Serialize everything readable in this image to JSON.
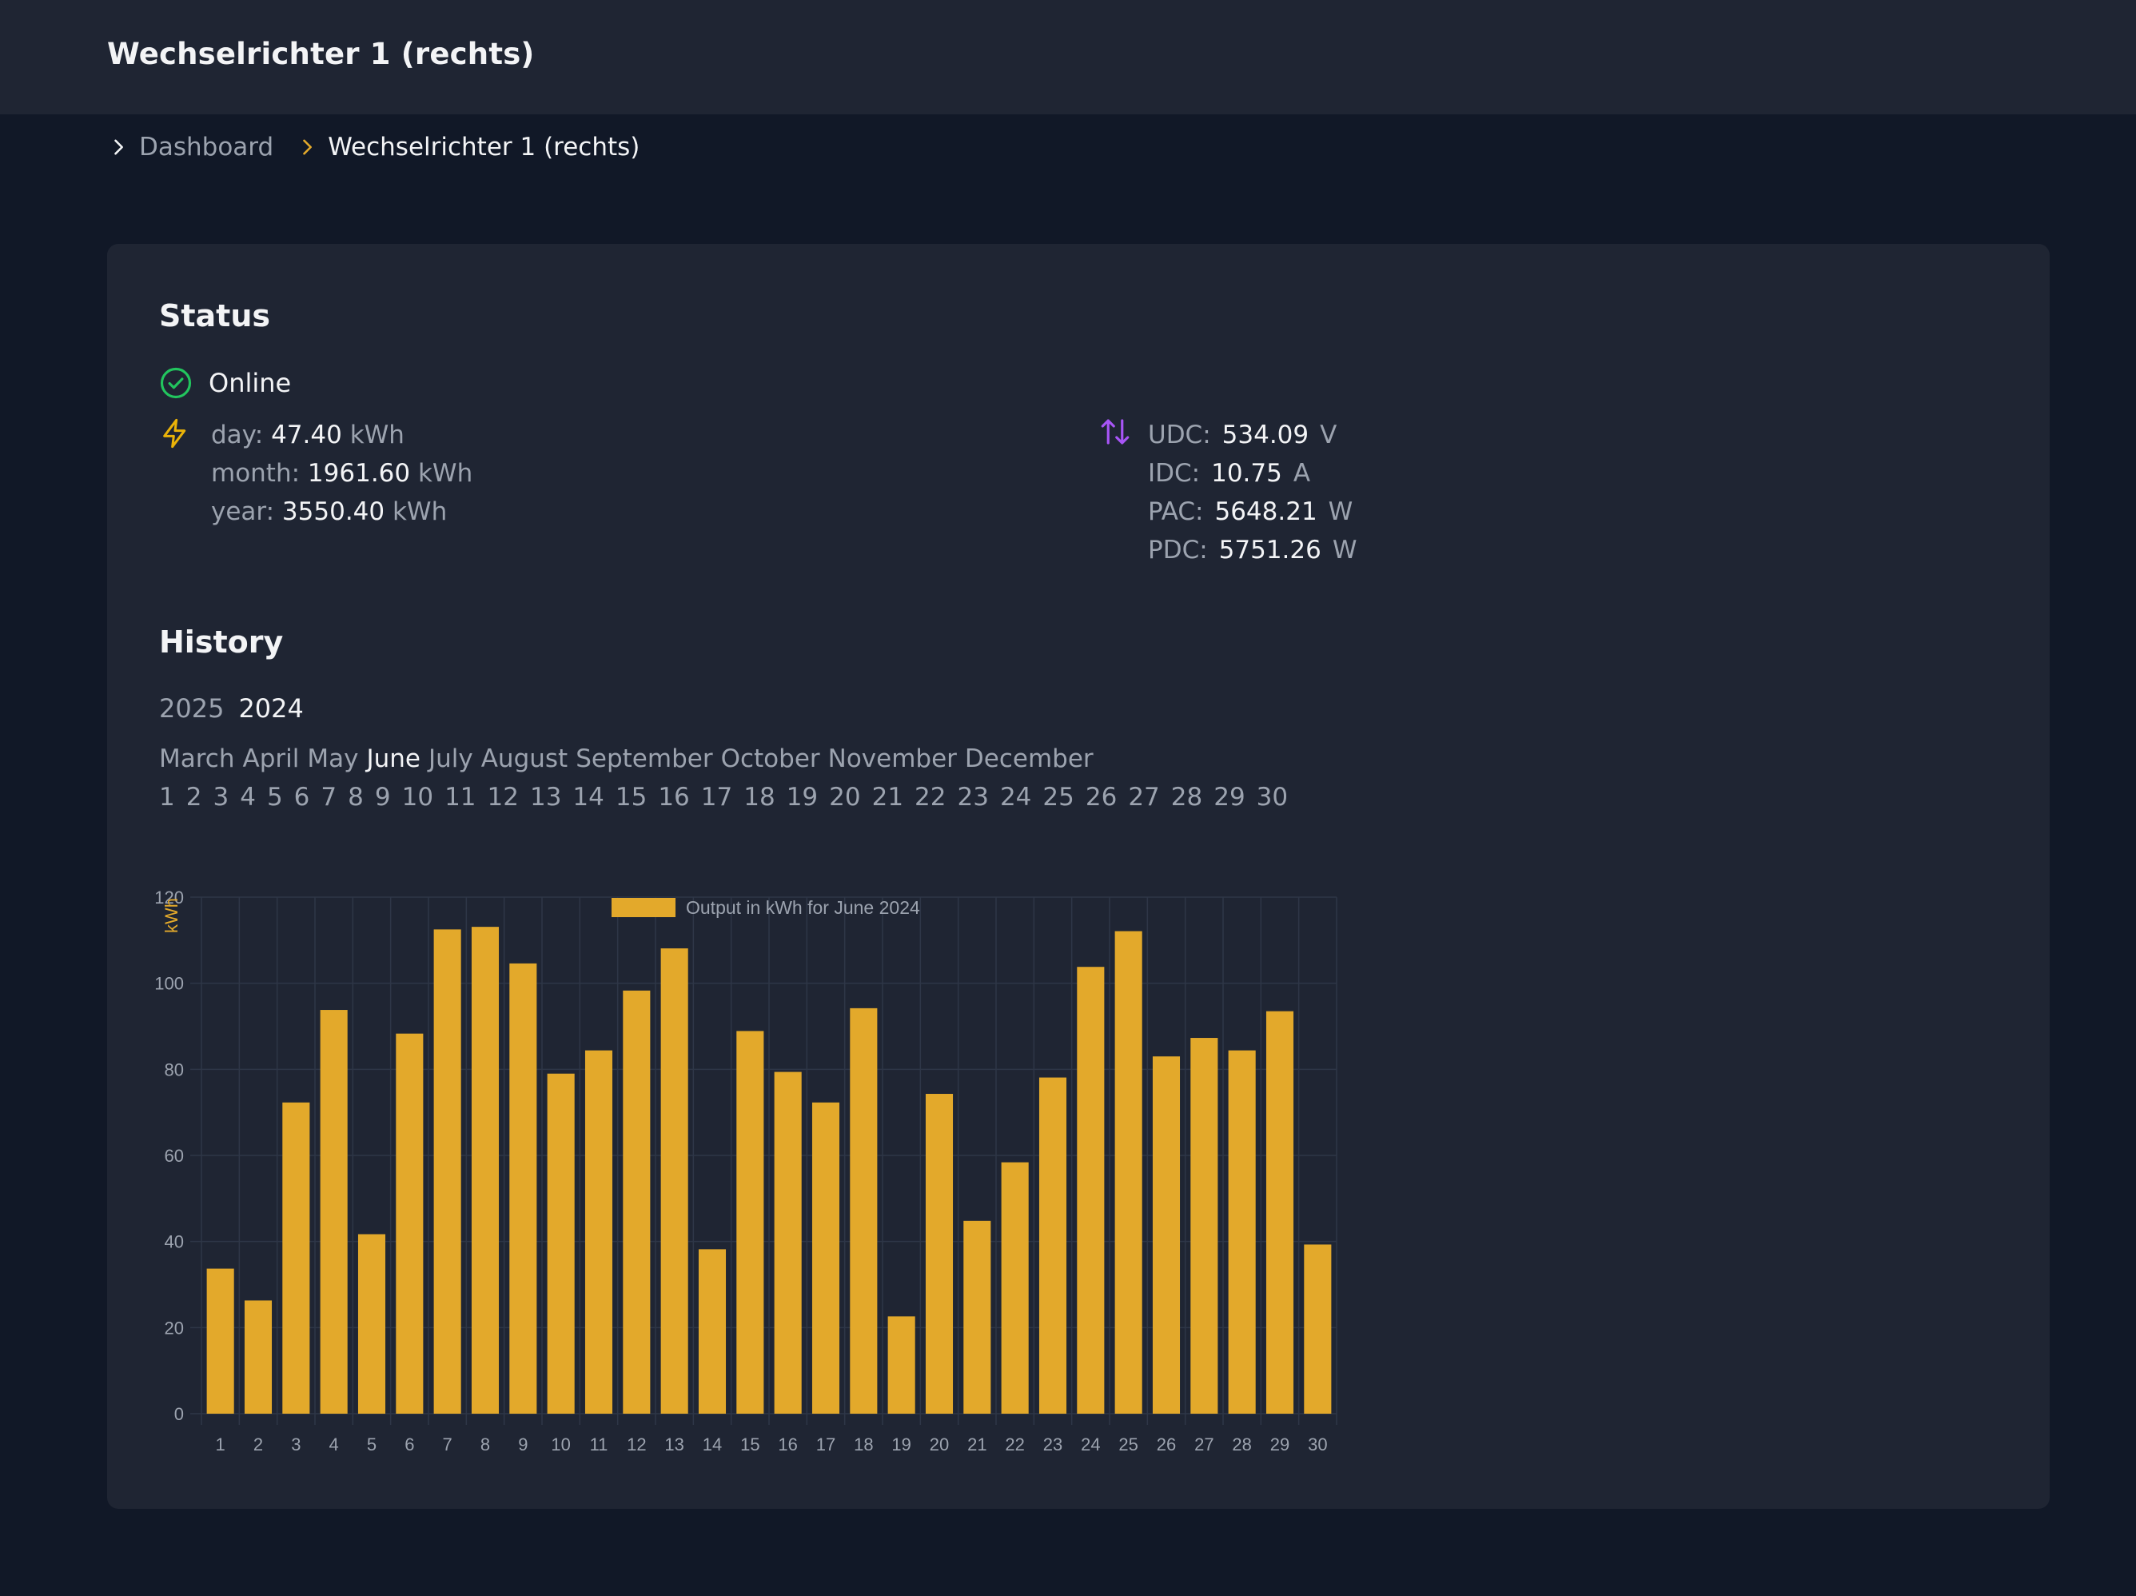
{
  "app": {
    "title": "Wechselrichter 1 (rechts)"
  },
  "breadcrumb": {
    "items": [
      "Dashboard",
      "Wechselrichter 1 (rechts)"
    ]
  },
  "status": {
    "heading": "Status",
    "state": "Online",
    "state_color": "#22c55e",
    "energy": [
      {
        "label": "day:",
        "value": "47.40",
        "unit": "kWh"
      },
      {
        "label": "month:",
        "value": "1961.60",
        "unit": "kWh"
      },
      {
        "label": "year:",
        "value": "3550.40",
        "unit": "kWh"
      }
    ],
    "electrical": [
      {
        "label": "UDC:",
        "value": "534.09",
        "unit": "V"
      },
      {
        "label": "IDC:",
        "value": "10.75",
        "unit": "A"
      },
      {
        "label": "PAC:",
        "value": "5648.21",
        "unit": "W"
      },
      {
        "label": "PDC:",
        "value": "5751.26",
        "unit": "W"
      }
    ]
  },
  "history": {
    "heading": "History",
    "years": [
      "2025",
      "2024"
    ],
    "selected_year": "2024",
    "months": [
      "March",
      "April",
      "May",
      "June",
      "July",
      "August",
      "September",
      "October",
      "November",
      "December"
    ],
    "selected_month": "June",
    "days": [
      "1",
      "2",
      "3",
      "4",
      "5",
      "6",
      "7",
      "8",
      "9",
      "10",
      "11",
      "12",
      "13",
      "14",
      "15",
      "16",
      "17",
      "18",
      "19",
      "20",
      "21",
      "22",
      "23",
      "24",
      "25",
      "26",
      "27",
      "28",
      "29",
      "30"
    ]
  },
  "colors": {
    "bar": "#e3a92b",
    "accent_bolt": "#eab308",
    "accent_arrows": "#a855f7"
  },
  "chart_data": {
    "type": "bar",
    "categories": [
      "1",
      "2",
      "3",
      "4",
      "5",
      "6",
      "7",
      "8",
      "9",
      "10",
      "11",
      "12",
      "13",
      "14",
      "15",
      "16",
      "17",
      "18",
      "19",
      "20",
      "21",
      "22",
      "23",
      "24",
      "25",
      "26",
      "27",
      "28",
      "29",
      "30"
    ],
    "series": [
      {
        "name": "Output in kWh for June 2024",
        "values": [
          33.7,
          26.3,
          72.3,
          93.8,
          41.7,
          88.3,
          112.5,
          113.1,
          104.6,
          79.0,
          84.4,
          98.3,
          108.1,
          38.2,
          88.9,
          79.4,
          72.3,
          94.2,
          22.6,
          74.3,
          44.8,
          58.4,
          78.1,
          103.8,
          112.1,
          83.0,
          87.3,
          84.4,
          93.5,
          39.3
        ]
      }
    ],
    "xlabel": "",
    "ylabel": "kWh",
    "ylim": [
      0,
      120
    ],
    "yticks": [
      0,
      20,
      40,
      60,
      80,
      100,
      120
    ],
    "grid": true,
    "legend": "top"
  }
}
